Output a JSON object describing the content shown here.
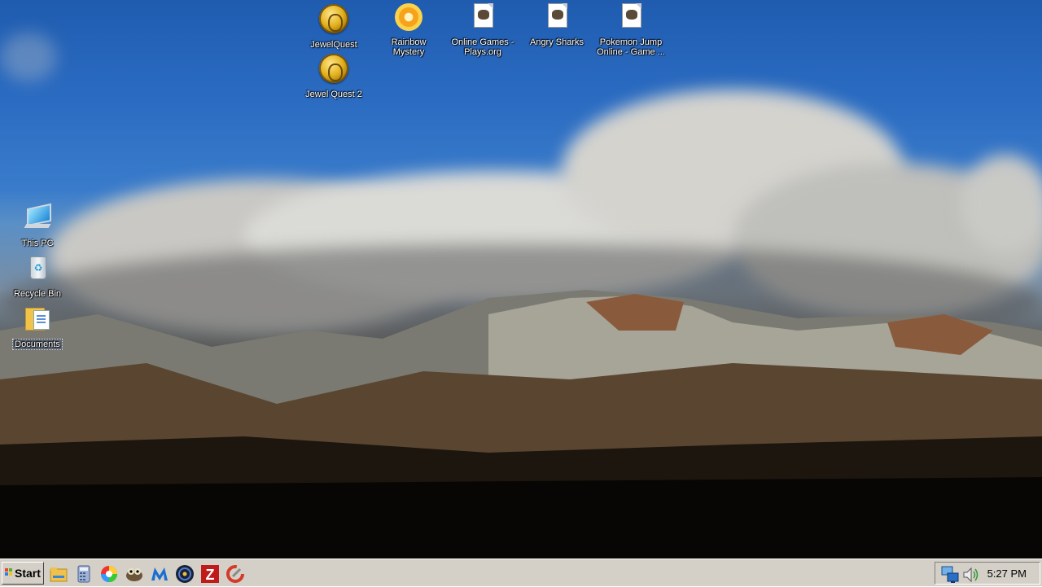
{
  "desktop": {
    "icons": [
      {
        "id": "jewelquest",
        "label": "JewelQuest",
        "icon": "jewel-quest-coin-icon"
      },
      {
        "id": "rainbow-mystery",
        "label": "Rainbow Mystery",
        "icon": "rainbow-mystery-sun-icon"
      },
      {
        "id": "online-games",
        "label": "Online Games - Plays.org",
        "icon": "web-shortcut-icon"
      },
      {
        "id": "angry-sharks",
        "label": "Angry Sharks",
        "icon": "web-shortcut-icon"
      },
      {
        "id": "pokemon-jump",
        "label": "Pokemon Jump Online - Game ...",
        "icon": "web-shortcut-icon"
      },
      {
        "id": "jewel-quest-2",
        "label": "Jewel Quest 2",
        "icon": "jewel-quest-coin-icon"
      },
      {
        "id": "this-pc",
        "label": "This PC",
        "icon": "computer-icon"
      },
      {
        "id": "recycle-bin",
        "label": "Recycle Bin",
        "icon": "recycle-bin-icon"
      },
      {
        "id": "documents",
        "label": "Documents",
        "icon": "documents-folder-icon",
        "selected": true
      }
    ]
  },
  "taskbar": {
    "start_label": "Start",
    "quick_launch": [
      "file-explorer-icon",
      "calculator-icon",
      "color-wheel-icon",
      "game-shortcut-icon",
      "malwarebytes-icon",
      "dark-app-icon",
      "filezilla-icon",
      "ccleaner-icon"
    ],
    "tray": {
      "icons": [
        "network-icon",
        "volume-icon"
      ],
      "clock": "5:27 PM"
    }
  },
  "colors": {
    "taskbar_bg": "#d4d0c8",
    "sky": "#2b6cc2"
  }
}
